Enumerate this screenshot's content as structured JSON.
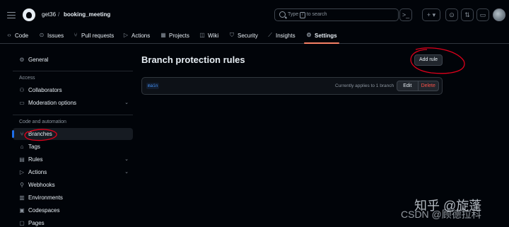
{
  "header": {
    "owner": "get36",
    "separator": "/",
    "repo": "booking_meeting",
    "search_prefix": "Type",
    "search_key": "/",
    "search_suffix": "to search"
  },
  "nav": {
    "tabs": [
      {
        "label": "Code",
        "icon": "code-icon"
      },
      {
        "label": "Issues",
        "icon": "issue-icon"
      },
      {
        "label": "Pull requests",
        "icon": "pull-request-icon"
      },
      {
        "label": "Actions",
        "icon": "play-icon"
      },
      {
        "label": "Projects",
        "icon": "table-icon"
      },
      {
        "label": "Wiki",
        "icon": "book-icon"
      },
      {
        "label": "Security",
        "icon": "shield-icon"
      },
      {
        "label": "Insights",
        "icon": "graph-icon"
      },
      {
        "label": "Settings",
        "icon": "gear-icon"
      }
    ]
  },
  "sidebar": {
    "general": "General",
    "access_heading": "Access",
    "collaborators": "Collaborators",
    "moderation": "Moderation options",
    "code_heading": "Code and automation",
    "branches": "Branches",
    "tags": "Tags",
    "rules": "Rules",
    "actions": "Actions",
    "webhooks": "Webhooks",
    "environments": "Environments",
    "codespaces": "Codespaces",
    "pages": "Pages"
  },
  "main": {
    "title": "Branch protection rules",
    "add_rule": "Add rule",
    "rule": {
      "pattern": "main",
      "applies": "Currently applies to 1 branch",
      "edit": "Edit",
      "delete": "Delete"
    }
  },
  "watermark": {
    "line1": "知乎 @旋蓬",
    "line2": "CSDN @顾德拉科"
  },
  "colors": {
    "accent_tab": "#f78166",
    "active_bar": "#1f6feb",
    "annotation": "#e0001b",
    "delete": "#f85149"
  }
}
